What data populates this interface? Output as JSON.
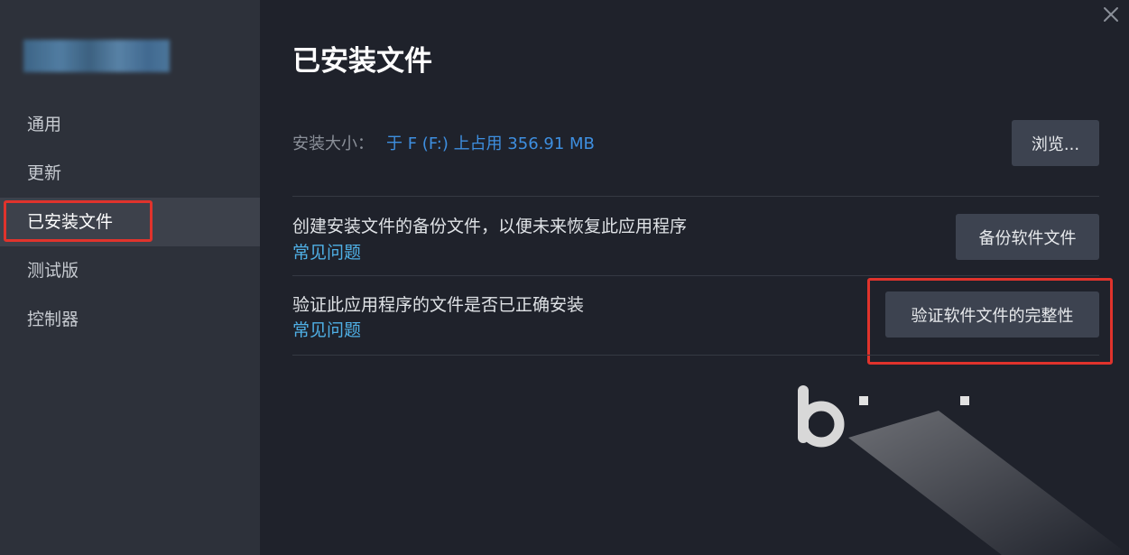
{
  "sidebar": {
    "items": [
      {
        "label": "通用"
      },
      {
        "label": "更新"
      },
      {
        "label": "已安装文件"
      },
      {
        "label": "测试版"
      },
      {
        "label": "控制器"
      }
    ]
  },
  "main": {
    "title": "已安装文件",
    "install_size": {
      "label": "安装大小：",
      "value": "于 F (F:) 上占用 356.91 MB",
      "browse_label": "浏览..."
    },
    "backup": {
      "description": "创建安装文件的备份文件，以便未来恢复此应用程序",
      "faq_label": "常见问题",
      "button_label": "备份软件文件"
    },
    "verify": {
      "description": "验证此应用程序的文件是否已正确安装",
      "faq_label": "常见问题",
      "button_label": "验证软件文件的完整性"
    }
  },
  "icons": {
    "close": "close-icon",
    "watermark": "bilibili-logo"
  },
  "colors": {
    "highlight": "#e0332c",
    "link": "#4fb0e6",
    "size_value": "#3e8fe0"
  }
}
